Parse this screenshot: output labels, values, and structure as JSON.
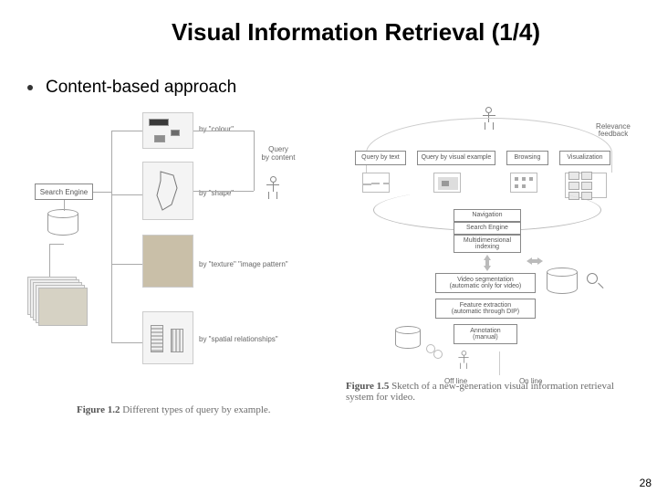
{
  "title": "Visual Information Retrieval (1/4)",
  "bullet": "Content-based approach",
  "page_number": "28",
  "fig_left": {
    "caption_bold": "Figure 1.2",
    "caption_rest": " Different types of query by example.",
    "search_engine": "Search Engine",
    "query_by_content": "Query\nby content",
    "by_colour": "by \"colour\"",
    "by_shape": "by \"shape\"",
    "by_texture": "by \"texture\"  \"image pattern\"",
    "by_spatial": "by \"spatial relationships\""
  },
  "fig_right": {
    "caption_bold": "Figure 1.5",
    "caption_rest": " Sketch of a new-generation visual information retrieval system for video.",
    "relevance_feedback": "Relevance\nfeedback",
    "query_by_text": "Query by text",
    "query_by_visual": "Query by visual example",
    "browsing": "Browsing",
    "visualization": "Visualization",
    "navigation": "Navigation",
    "search_engine": "Search Engine",
    "multidimensional_indexing": "Multidimensional\nindexing",
    "video_segmentation": "Video segmentation\n(automatic only for video)",
    "feature_extraction": "Feature extraction\n(automatic through DIP)",
    "annotation": "Annotation\n(manual)",
    "off_line": "Off line",
    "on_line": "On line"
  }
}
